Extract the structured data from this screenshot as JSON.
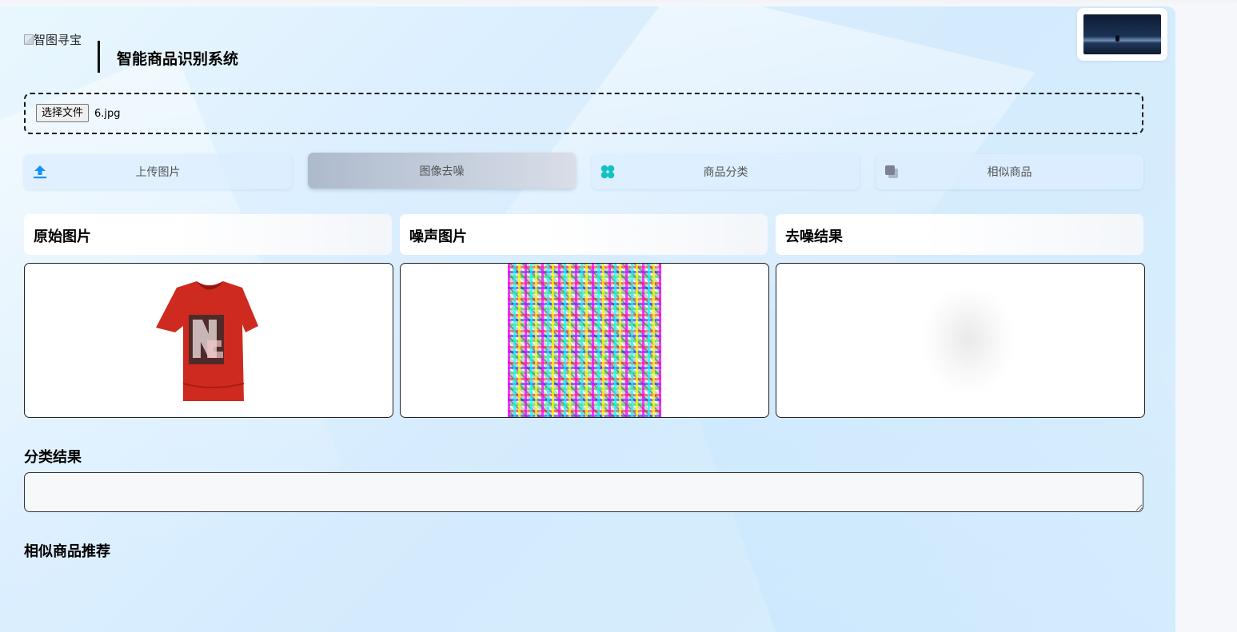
{
  "header": {
    "logo_alt": "智图寻宝",
    "title": "智能商品识别系统"
  },
  "upload": {
    "file_button_label": "选择文件",
    "file_name": "6.jpg"
  },
  "actions": [
    {
      "label": "上传图片",
      "icon": "upload-icon",
      "icon_color": "#1890ff",
      "active": false
    },
    {
      "label": "图像去噪",
      "icon": "",
      "active": true
    },
    {
      "label": "商品分类",
      "icon": "clover-icon",
      "icon_color": "#13c2c2",
      "active": false
    },
    {
      "label": "相似商品",
      "icon": "copy-icon",
      "icon_color": "#8c8fa6",
      "active": false
    }
  ],
  "panels": {
    "original": {
      "title": "原始图片"
    },
    "noise": {
      "title": "噪声图片"
    },
    "denoised": {
      "title": "去噪结果"
    }
  },
  "results": {
    "classification_title": "分类结果",
    "classification_value": "",
    "similar_title": "相似商品推荐"
  }
}
